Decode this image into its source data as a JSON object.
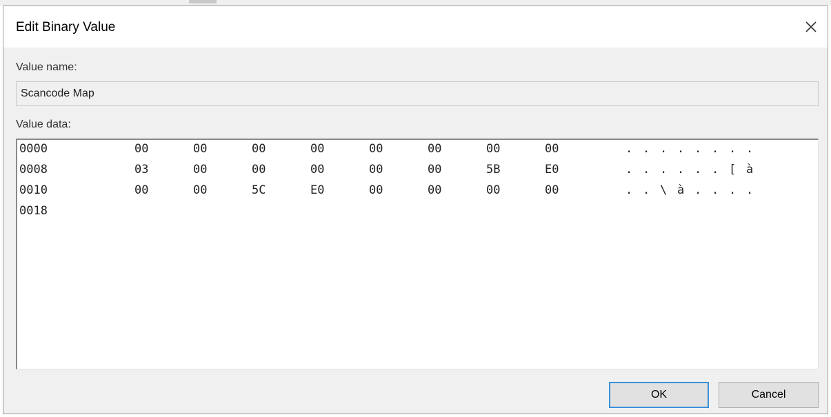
{
  "dialog": {
    "title": "Edit Binary Value",
    "close_icon": "close-icon"
  },
  "value_name": {
    "label": "Value name:",
    "value": "Scancode Map"
  },
  "value_data": {
    "label": "Value data:",
    "rows": [
      {
        "offset": "0000",
        "bytes": [
          "00",
          "00",
          "00",
          "00",
          "00",
          "00",
          "00",
          "00"
        ],
        "ascii": [
          ".",
          ".",
          ".",
          ".",
          ".",
          ".",
          ".",
          "."
        ]
      },
      {
        "offset": "0008",
        "bytes": [
          "03",
          "00",
          "00",
          "00",
          "00",
          "00",
          "5B",
          "E0"
        ],
        "ascii": [
          ".",
          ".",
          ".",
          ".",
          ".",
          ".",
          "[",
          "à"
        ]
      },
      {
        "offset": "0010",
        "bytes": [
          "00",
          "00",
          "5C",
          "E0",
          "00",
          "00",
          "00",
          "00"
        ],
        "ascii": [
          ".",
          ".",
          "\\",
          "à",
          ".",
          ".",
          ".",
          "."
        ]
      },
      {
        "offset": "0018",
        "bytes": [],
        "ascii": []
      }
    ]
  },
  "buttons": {
    "ok": "OK",
    "cancel": "Cancel"
  }
}
